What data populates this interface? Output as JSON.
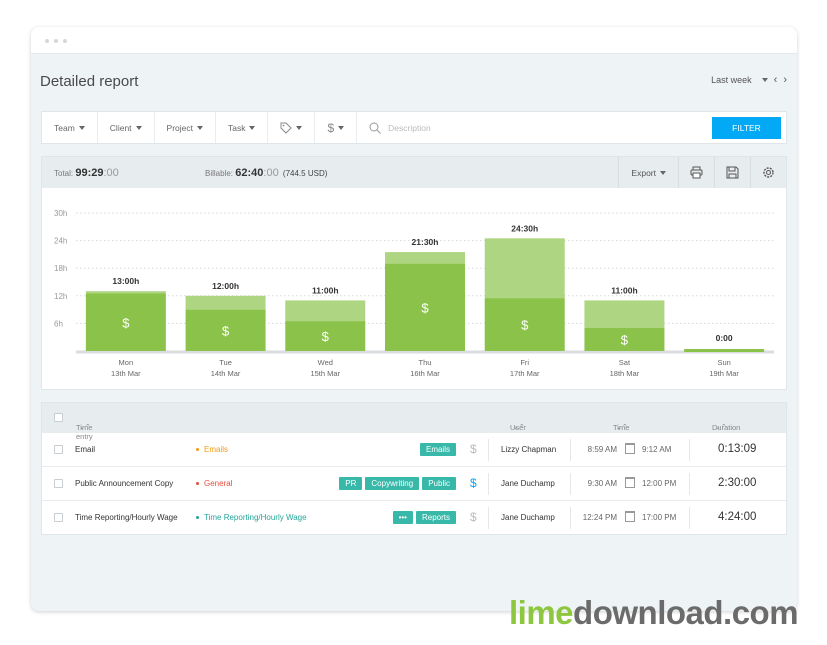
{
  "header": {
    "title": "Detailed report",
    "period": "Last week"
  },
  "filters": {
    "team": "Team",
    "client": "Client",
    "project": "Project",
    "task": "Task",
    "tag_icon": "tag-icon",
    "billable_icon": "dollar-icon",
    "search_placeholder": "Description",
    "filter_button": "FILTER"
  },
  "summary": {
    "total_label": "Total:",
    "total_main": "99:29",
    "total_sec": ":00",
    "billable_label": "Billable:",
    "billable_main": "62:40",
    "billable_sec": ":00",
    "billable_amount": "(744.5 USD)",
    "export_label": "Export",
    "actions": [
      "print-icon",
      "save-icon",
      "settings-icon"
    ]
  },
  "chart_data": {
    "type": "bar",
    "stacked": true,
    "ylim": [
      0,
      30
    ],
    "yticks": [
      "30h",
      "24h",
      "18h",
      "12h",
      "6h"
    ],
    "categories": [
      "Mon 13th Mar",
      "Tue 14th Mar",
      "Wed 15th Mar",
      "Thu 16th Mar",
      "Fri 17th Mar",
      "Sat 18th Mar",
      "Sun 19th Mar"
    ],
    "days": [
      "Mon",
      "Tue",
      "Wed",
      "Thu",
      "Fri",
      "Sat",
      "Sun"
    ],
    "dates": [
      "13th Mar",
      "14th Mar",
      "15th Mar",
      "16th Mar",
      "17th Mar",
      "18th Mar",
      "19th Mar"
    ],
    "totals_labels": [
      "13:00h",
      "12:00h",
      "11:00h",
      "21:30h",
      "24:30h",
      "11:00h",
      "0:00"
    ],
    "series": [
      {
        "values": [
          12.5,
          9,
          6.5,
          19,
          11.5,
          5,
          0
        ],
        "color": "#8bc34a"
      },
      {
        "values": [
          0.5,
          3,
          4.5,
          2.5,
          13,
          6,
          0
        ],
        "color": "#aed581"
      }
    ],
    "billable_marker": "$",
    "grid": true
  },
  "table": {
    "headers": {
      "entry": "Time entry",
      "user": "User",
      "time": "Time",
      "duration": "Duration"
    },
    "rows": [
      {
        "description": "Email",
        "project": "Emails",
        "project_color": "#f39c12",
        "tags": [
          "Emails"
        ],
        "billable_color": "#bbbbbb",
        "user": "Lizzy Chapman",
        "start": "8:59 AM",
        "end": "9:12 AM",
        "duration": "0:13:09"
      },
      {
        "description": "Public Announcement Copy",
        "project": "General",
        "project_color": "#e74c3c",
        "tags": [
          "PR",
          "Copywriting",
          "Public"
        ],
        "billable_color": "#03a9f4",
        "user": "Jane Duchamp",
        "start": "9:30 AM",
        "end": "12:00 PM",
        "duration": "2:30:00"
      },
      {
        "description": "Time Reporting/Hourly Wage",
        "project": "Time Reporting/Hourly Wage",
        "project_color": "#26a69a",
        "tags": [
          "•••",
          "Reports"
        ],
        "billable_color": "#bbbbbb",
        "user": "Jane Duchamp",
        "start": "12:24 PM",
        "end": "17:00 PM",
        "duration": "4:24:00"
      }
    ]
  },
  "watermark": {
    "part1": "lime",
    "part2": "download.com"
  }
}
